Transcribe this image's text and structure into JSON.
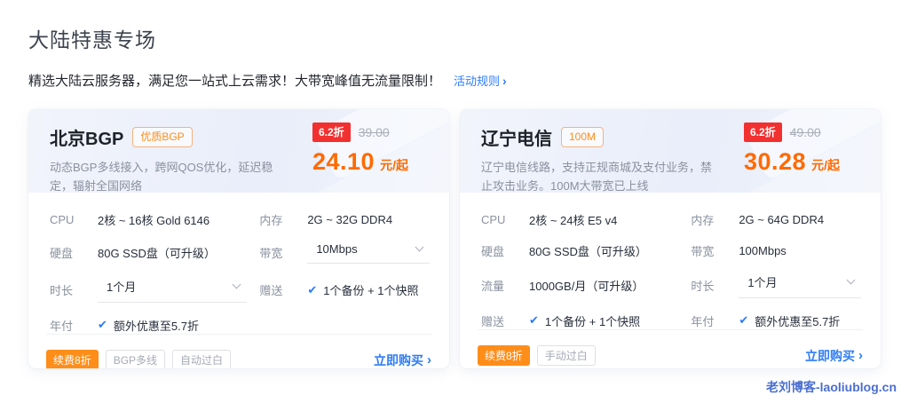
{
  "page": {
    "title": "大陆特惠专场",
    "subtitle": "精选大陆云服务器，满足您一站式上云需求！大带宽峰值无流量限制！",
    "rules_link": "活动规则",
    "watermark": "老刘博客-laoliublog.cn"
  },
  "icons": {
    "check": "✔",
    "arrow": "›",
    "chevron_down": "chevron-down"
  },
  "colors": {
    "accent_blue": "#2e7cf6",
    "price_orange": "#ff6a00",
    "discount_red": "#f23030",
    "tag_orange": "#ff8d1a",
    "watermark_blue": "#4a6ed0"
  },
  "cards": [
    {
      "title": "北京BGP",
      "badge": "优质BGP",
      "description": "动态BGP多线接入，跨网QOS优化，延迟稳定，辐射全国网络",
      "discount": "6.2折",
      "original_price": "39.00",
      "price": "24.10",
      "price_unit": "元/起",
      "specs": [
        {
          "label": "CPU",
          "value": "2核 ~ 16核 Gold 6146",
          "type": "text"
        },
        {
          "label": "内存",
          "value": "2G ~ 32G DDR4",
          "type": "text"
        },
        {
          "label": "硬盘",
          "value": "80G SSD盘（可升级）",
          "type": "text"
        },
        {
          "label": "带宽",
          "value": "10Mbps",
          "type": "select"
        },
        {
          "label": "时长",
          "value": "1个月",
          "type": "select"
        },
        {
          "label": "赠送",
          "value": "1个备份 + 1个快照",
          "type": "check"
        },
        {
          "label": "年付",
          "value": "额外优惠至5.7折",
          "type": "check"
        }
      ],
      "tags": [
        {
          "label": "续费8折",
          "style": "solid"
        },
        {
          "label": "BGP多线",
          "style": "outline"
        },
        {
          "label": "自动过白",
          "style": "outline"
        }
      ],
      "buy_label": "立即购买"
    },
    {
      "title": "辽宁电信",
      "badge": "100M",
      "description": "辽宁电信线路，支持正规商城及支付业务，禁止攻击业务。100M大带宽已上线",
      "discount": "6.2折",
      "original_price": "49.00",
      "price": "30.28",
      "price_unit": "元/起",
      "specs": [
        {
          "label": "CPU",
          "value": "2核 ~ 24核 E5 v4",
          "type": "text"
        },
        {
          "label": "内存",
          "value": "2G ~ 64G DDR4",
          "type": "text"
        },
        {
          "label": "硬盘",
          "value": "80G SSD盘（可升级）",
          "type": "text"
        },
        {
          "label": "带宽",
          "value": "100Mbps",
          "type": "text"
        },
        {
          "label": "流量",
          "value": "1000GB/月（可升级）",
          "type": "text"
        },
        {
          "label": "时长",
          "value": "1个月",
          "type": "select"
        },
        {
          "label": "赠送",
          "value": "1个备份 + 1个快照",
          "type": "check"
        },
        {
          "label": "年付",
          "value": "额外优惠至5.7折",
          "type": "check"
        }
      ],
      "tags": [
        {
          "label": "续费8折",
          "style": "solid"
        },
        {
          "label": "手动过白",
          "style": "outline"
        }
      ],
      "buy_label": "立即购买"
    }
  ]
}
